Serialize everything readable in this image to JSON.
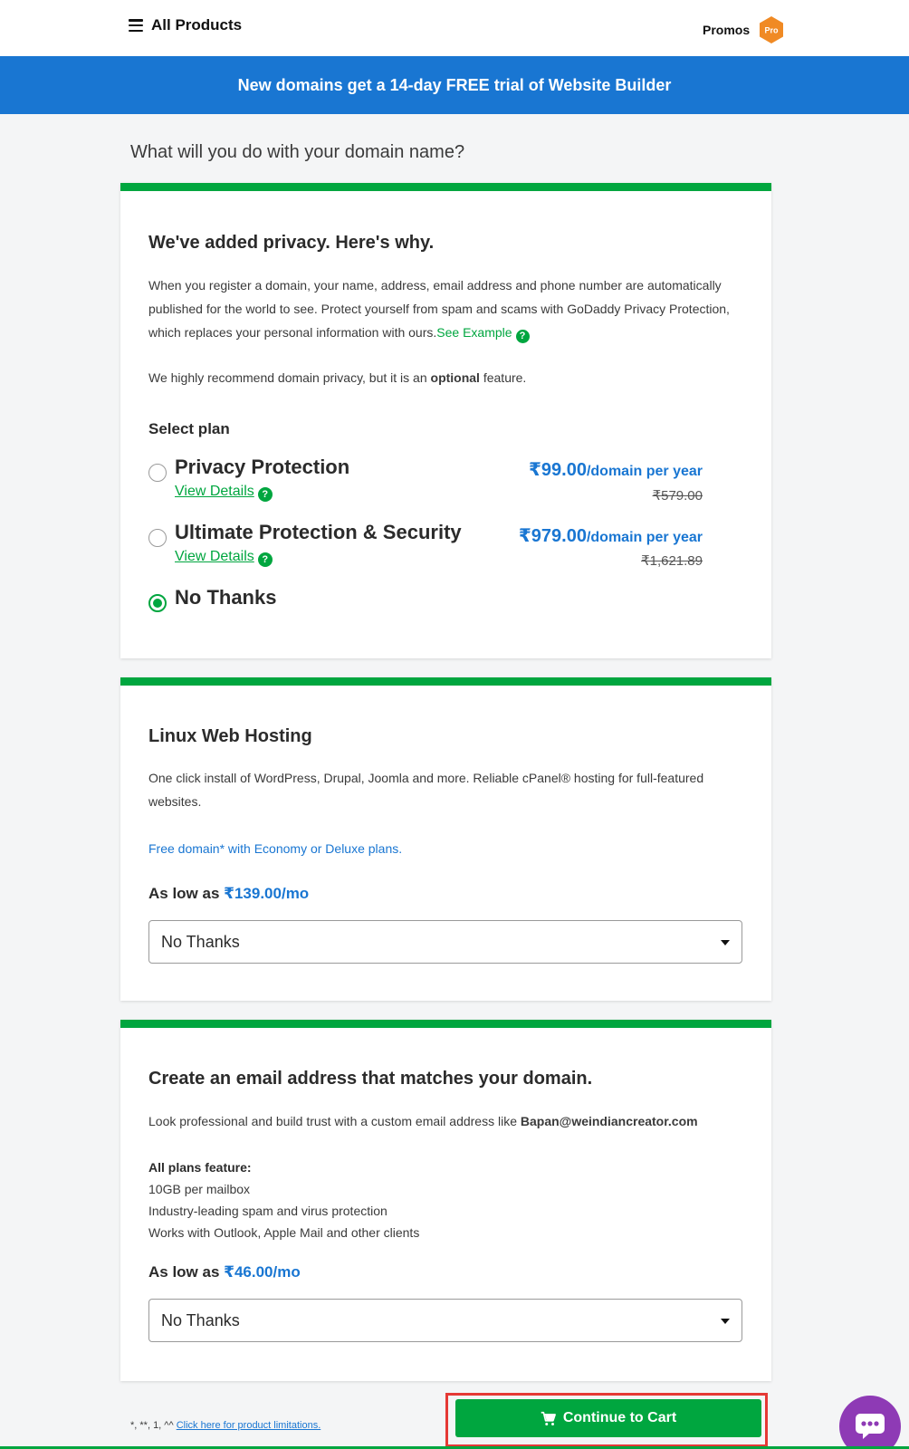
{
  "header": {
    "menu_label": "All Products",
    "promos_label": "Promos",
    "pro_badge": "Pro"
  },
  "banner": {
    "text": "New domains get a 14-day FREE trial of Website Builder"
  },
  "question": "What will you do with your domain name?",
  "privacy_card": {
    "title": "We've added privacy. Here's why.",
    "description": "When you register a domain, your name, address, email address and phone number are automatically published for the world to see. Protect yourself from spam and scams with GoDaddy Privacy Protection, which replaces your personal information with ours.",
    "see_example": "See Example",
    "recommend_prefix": "We highly recommend domain privacy, but it is an ",
    "recommend_bold": "optional",
    "recommend_suffix": " feature.",
    "select_plan": "Select plan",
    "plans": [
      {
        "name": "Privacy Protection",
        "view_details": "View Details",
        "price": "₹99.00",
        "per": "/domain per year",
        "old_price": "₹579.00",
        "selected": false
      },
      {
        "name": "Ultimate Protection & Security",
        "view_details": "View Details",
        "price": "₹979.00",
        "per": "/domain per year",
        "old_price": "₹1,621.89",
        "selected": false
      },
      {
        "name": "No Thanks",
        "selected": true
      }
    ]
  },
  "hosting_card": {
    "title": "Linux Web Hosting",
    "description": "One click install of WordPress, Drupal, Joomla and more. Reliable cPanel® hosting for full-featured websites.",
    "free_domain_link": "Free domain* with Economy or Deluxe plans.",
    "as_low_as": "As low as ",
    "price": "₹139.00/mo",
    "dropdown_value": "No Thanks"
  },
  "email_card": {
    "title": "Create an email address that matches your domain.",
    "description_prefix": "Look professional and build trust with a custom email address like ",
    "description_email": "Bapan@weindiancreator.com",
    "features_head": "All plans feature:",
    "features": [
      "10GB per mailbox",
      "Industry-leading spam and virus protection",
      "Works with Outlook, Apple Mail and other clients"
    ],
    "as_low_as": "As low as ",
    "price": "₹46.00/mo",
    "dropdown_value": "No Thanks"
  },
  "footer": {
    "footnote_marks": "*, **, 1, ^^ ",
    "limitations_link": "Click here for product limitations.",
    "continue_label": "Continue to Cart"
  },
  "colors": {
    "brand_blue": "#1976d2",
    "accent_green": "#00a63f",
    "highlight_red": "#e53935",
    "chat_purple": "#8e3ab5",
    "pro_orange": "#f08a24"
  },
  "icons": {
    "menu": "hamburger-icon",
    "promos_badge": "hexagon-pro-icon",
    "help": "question-circle-icon",
    "cart": "cart-icon",
    "chat": "chat-bubble-icon",
    "dropdown": "caret-down-icon"
  }
}
